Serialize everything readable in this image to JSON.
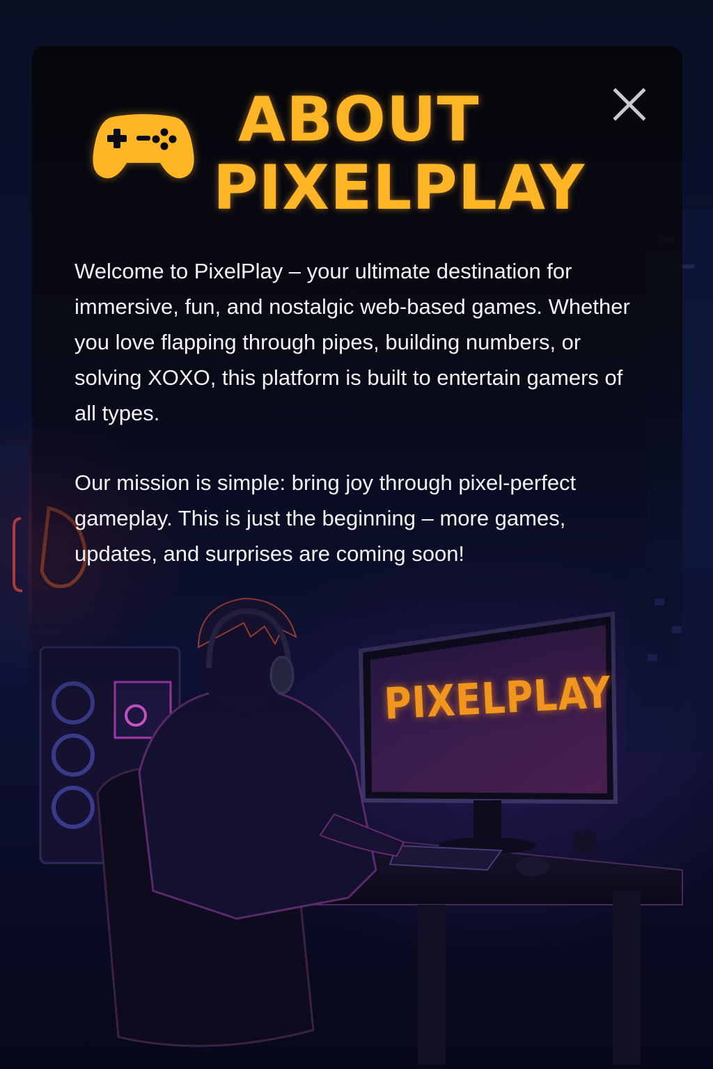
{
  "modal": {
    "title_line_1": "ABOUT",
    "title_line_2": "PIXELPLAY",
    "paragraphs": [
      "Welcome to PixelPlay – your ultimate destination for immersive, fun, and nostalgic web-based games. Whether you love flapping through pipes, building numbers, or solving XOXO, this platform is built to entertain gamers of all types.",
      "Our mission is simple: bring joy through pixel-perfect gameplay. This is just the beginning – more games, updates, and surprises are coming soon!"
    ],
    "icons": {
      "title_icon": "game-controller-icon",
      "close_icon": "close-icon"
    }
  },
  "illustration": {
    "monitor_text": "PIXELPLAY"
  },
  "colors": {
    "accent": "#ffb626",
    "text": "#f3f3f6",
    "background": "#0b1230",
    "close": "#c9c9cf"
  }
}
